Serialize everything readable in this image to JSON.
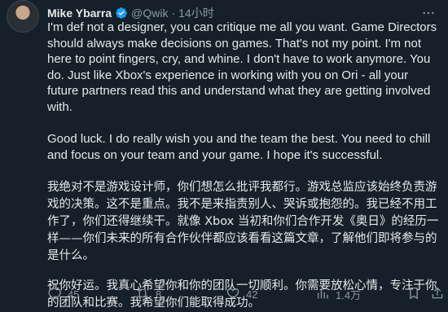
{
  "tweet": {
    "author_name": "Mike Ybarra",
    "handle": "@Qwik",
    "separator": "·",
    "time": "14小时",
    "paragraphs": [
      "I'm def not a designer, you can critique me all you want. Game Directors should always make decisions on games. That's not my point. I'm not here to point fingers, cry, and whine. I don't have to work anymore. You do. Just like Xbox's experience in working with you on Ori - all your future partners read this and understand what they are getting involved with.",
      "Good luck. I do really wish you and the team the best. You need to chill and focus on your team and your game. I hope it's successful.",
      "我绝对不是游戏设计师，你们想怎么批评我都行。游戏总监应该始终负责游戏的决策。这不是重点。我不是来指责别人、哭诉或抱怨的。我已经不用工作了，你们还得继续干。就像 Xbox 当初和你们合作开发《奥日》的经历一样——你们未来的所有合作伙伴都应该看看这篇文章，了解他们即将参与的是什么。",
      "祝你好运。我真心希望你和你的团队一切顺利。你需要放松心情，专注于你的团队和比赛。我希望你们能取得成功。"
    ]
  },
  "actions": {
    "reply_count": "45",
    "retweet_count": "8",
    "like_count": "42",
    "view_count": "1.4万"
  },
  "colors": {
    "background": "#15202b",
    "text": "#e7e9ea",
    "muted": "#8b98a5",
    "verified": "#1d9bf0"
  }
}
